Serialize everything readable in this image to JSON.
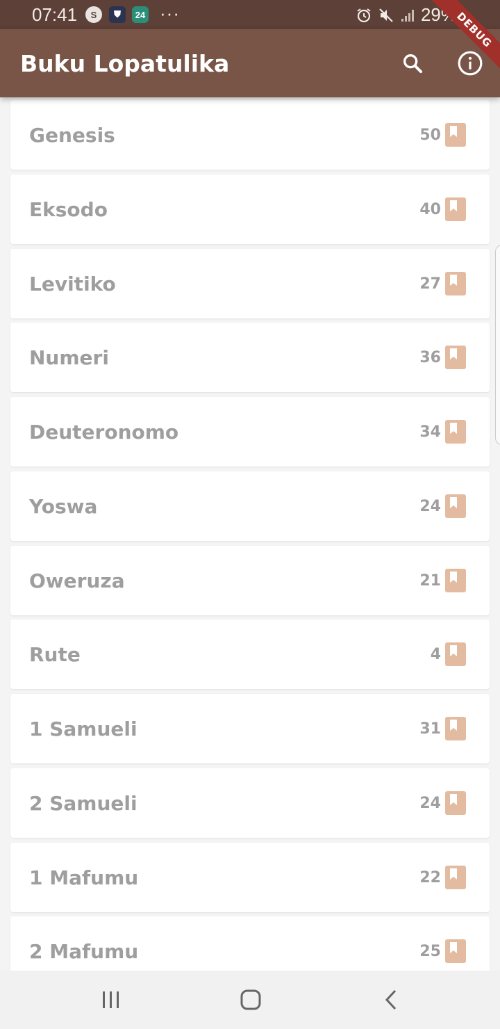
{
  "status_bar": {
    "time": "07:41",
    "notifications": [
      {
        "name": "s-app-icon",
        "glyph": "S"
      },
      {
        "name": "shield-app-icon",
        "glyph": "⛊"
      },
      {
        "name": "calendar-24-icon",
        "glyph": "24"
      }
    ],
    "more_indicator": "···",
    "battery_text": "29%"
  },
  "app_bar": {
    "title": "Buku Lopatulika",
    "search_icon": "search-icon",
    "info_icon": "info-icon"
  },
  "debug_banner": "DEBUG",
  "books": [
    {
      "name": "Genesis",
      "count": "50"
    },
    {
      "name": "Eksodo",
      "count": "40"
    },
    {
      "name": "Levitiko",
      "count": "27"
    },
    {
      "name": "Numeri",
      "count": "36"
    },
    {
      "name": "Deuteronomo",
      "count": "34"
    },
    {
      "name": "Yoswa",
      "count": "24"
    },
    {
      "name": "Oweruza",
      "count": "21"
    },
    {
      "name": "Rute",
      "count": "4"
    },
    {
      "name": "1 Samueli",
      "count": "31"
    },
    {
      "name": "2 Samueli",
      "count": "24"
    },
    {
      "name": "1 Mafumu",
      "count": "22"
    },
    {
      "name": "2 Mafumu",
      "count": "25"
    }
  ],
  "colors": {
    "status_bar": "#5d4037",
    "app_bar": "#795548",
    "book_icon": "#e3bba0",
    "text_grey": "#9e9e9e",
    "debug_banner": "#a1302b"
  },
  "nav_bar": {
    "recent_icon": "recent-apps-icon",
    "home_icon": "home-icon",
    "back_icon": "back-icon"
  }
}
